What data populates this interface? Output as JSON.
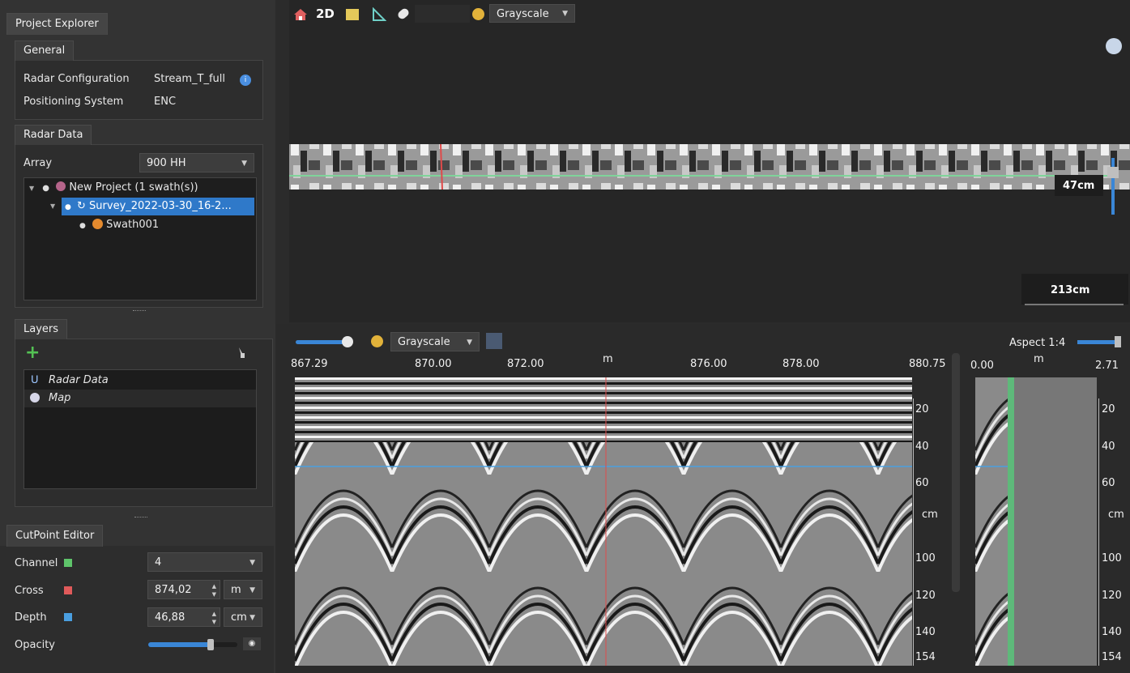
{
  "project_explorer": {
    "title": "Project Explorer"
  },
  "general": {
    "title": "General",
    "radar_config_label": "Radar Configuration",
    "radar_config_value": "Stream_T_full",
    "positioning_label": "Positioning System",
    "positioning_value": "ENC"
  },
  "radar_data": {
    "title": "Radar Data",
    "array_label": "Array",
    "array_value": "900 HH",
    "tree": [
      {
        "label": "New Project (1 swath(s))"
      },
      {
        "label": "Survey_2022-03-30_16-2..."
      },
      {
        "label": "Swath001"
      }
    ]
  },
  "layers": {
    "title": "Layers",
    "items": [
      {
        "label": "Radar Data"
      },
      {
        "label": "Map"
      }
    ]
  },
  "cutpoint": {
    "title": "CutPoint Editor",
    "channel_label": "Channel",
    "channel_value": "4",
    "cross_label": "Cross",
    "cross_value": "874,02",
    "cross_unit": "m",
    "depth_label": "Depth",
    "depth_value": "46,88",
    "depth_unit": "cm",
    "opacity_label": "Opacity",
    "opacity_level": 0.7,
    "colors": {
      "channel": "#5ec46a",
      "cross": "#e05a5a",
      "depth": "#4a9fe0"
    }
  },
  "top_toolbar": {
    "mode_label": "2D",
    "palette": "Grayscale"
  },
  "top_view": {
    "depth_label": "47cm",
    "width_label": "213cm"
  },
  "bottom_toolbar": {
    "palette": "Grayscale",
    "aspect": "Aspect 1:4"
  },
  "bscan": {
    "x_ticks": [
      "867.29",
      "870.00",
      "872.00",
      "m",
      "876.00",
      "878.00",
      "880.75"
    ],
    "y_ticks": [
      "20",
      "40",
      "60",
      "cm",
      "100",
      "120",
      "140",
      "154"
    ]
  },
  "side_scan": {
    "x_ticks": [
      "0.00",
      "m",
      "2.71"
    ],
    "y_ticks": [
      "20",
      "40",
      "60",
      "cm",
      "100",
      "120",
      "140",
      "154"
    ]
  },
  "icons": [
    "home-icon",
    "2d-icon",
    "grid-icon",
    "measure-icon",
    "pen-icon",
    "palette-icon",
    "globe-icon",
    "add-icon",
    "brush-icon",
    "eye-icon",
    "cube-icon"
  ]
}
